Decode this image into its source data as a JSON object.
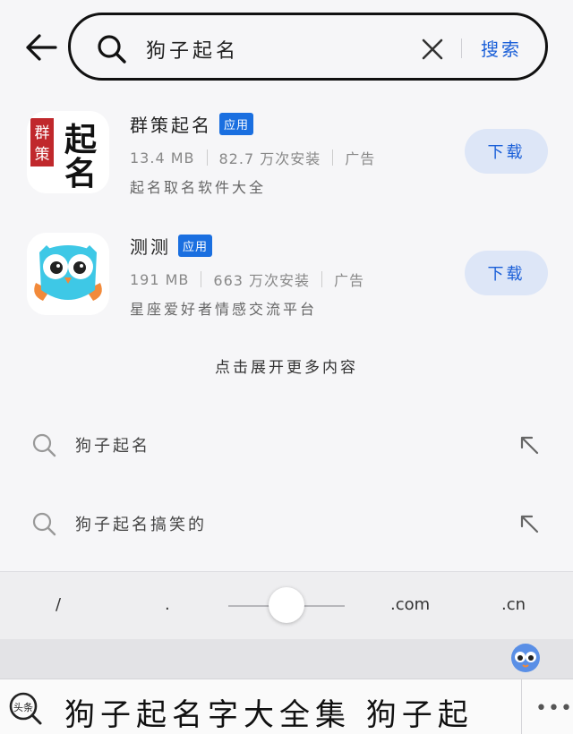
{
  "search": {
    "query": "狗子起名",
    "button_label": "搜索"
  },
  "apps": [
    {
      "name": "群策起名",
      "badge": "应用",
      "size": "13.4 MB",
      "installs": "82.7 万次安装",
      "tag": "广告",
      "description": "起名取名软件大全",
      "download_label": "下载",
      "icon": "qunce-calligraphy-icon"
    },
    {
      "name": "测测",
      "badge": "应用",
      "size": "191 MB",
      "installs": "663 万次安装",
      "tag": "广告",
      "description": "星座爱好者情感交流平台",
      "download_label": "下载",
      "icon": "owl-icon"
    }
  ],
  "more_label": "点击展开更多内容",
  "suggestions": [
    {
      "text": "狗子起名"
    },
    {
      "text": "狗子起名搞笑的"
    }
  ],
  "keyboard": {
    "shortcuts": [
      "/",
      ".",
      ".com",
      ".cn"
    ],
    "candidate_logo": "头条",
    "candidate_text": "狗子起名字大全集   狗子起",
    "more_symbol": "•••"
  },
  "colors": {
    "accent": "#1a5fd8",
    "badge": "#1a6fe0",
    "download_bg": "#dde6f7",
    "background": "#f6f6f8"
  }
}
